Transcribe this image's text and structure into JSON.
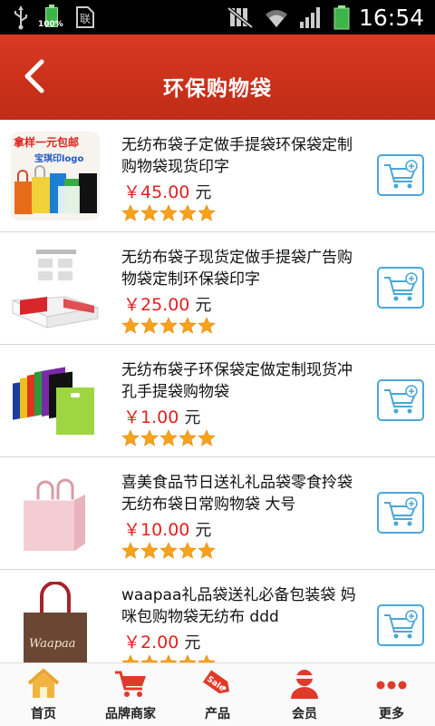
{
  "status_bar": {
    "battery_small_label": "100%",
    "time": "16:54",
    "icons": [
      "usb-icon",
      "battery-icon",
      "sim-icon",
      "mute-icon",
      "wifi-icon",
      "signal-icon",
      "battery-icon"
    ]
  },
  "header": {
    "title": "环保购物袋",
    "back_icon": "chevron-left-icon",
    "color": "#cc331d"
  },
  "products": [
    {
      "name": "无纺布袋子定做手提袋环保袋定制购物袋现货印字",
      "price": "￥45.00",
      "unit": "元",
      "rating": 5,
      "thumb_text_top": "拿样一元包邮",
      "thumb_text_bottom": "宝琪印logo"
    },
    {
      "name": "无纺布袋子现货定做手提袋广告购物袋定制环保袋印字",
      "price": "￥25.00",
      "unit": "元",
      "rating": 5
    },
    {
      "name": "无纺布袋子环保袋定做定制现货冲孔手提袋购物袋",
      "price": "￥1.00",
      "unit": "元",
      "rating": 5
    },
    {
      "name": "喜美食品节日送礼礼品袋零食拎袋无纺布袋日常购物袋 大号",
      "price": "￥10.00",
      "unit": "元",
      "rating": 5
    },
    {
      "name": "waapaa礼品袋送礼必备包装袋 妈咪包购物袋无纺布 ddd",
      "price": "￥2.00",
      "unit": "元",
      "rating": 5,
      "thumb_text": "Waapaa"
    }
  ],
  "bottom_nav": [
    {
      "label": "首页",
      "icon": "home-icon"
    },
    {
      "label": "品牌商家",
      "icon": "cart-icon"
    },
    {
      "label": "产品",
      "icon": "sale-tag-icon",
      "icon_text": "Sale"
    },
    {
      "label": "会员",
      "icon": "user-icon"
    },
    {
      "label": "更多",
      "icon": "more-dots-icon"
    }
  ],
  "colors": {
    "accent": "#cc331d",
    "price": "#e32020",
    "star": "#f7a21b",
    "cart_border": "#4aa7d8",
    "nav_icon": "#e03a2a"
  }
}
